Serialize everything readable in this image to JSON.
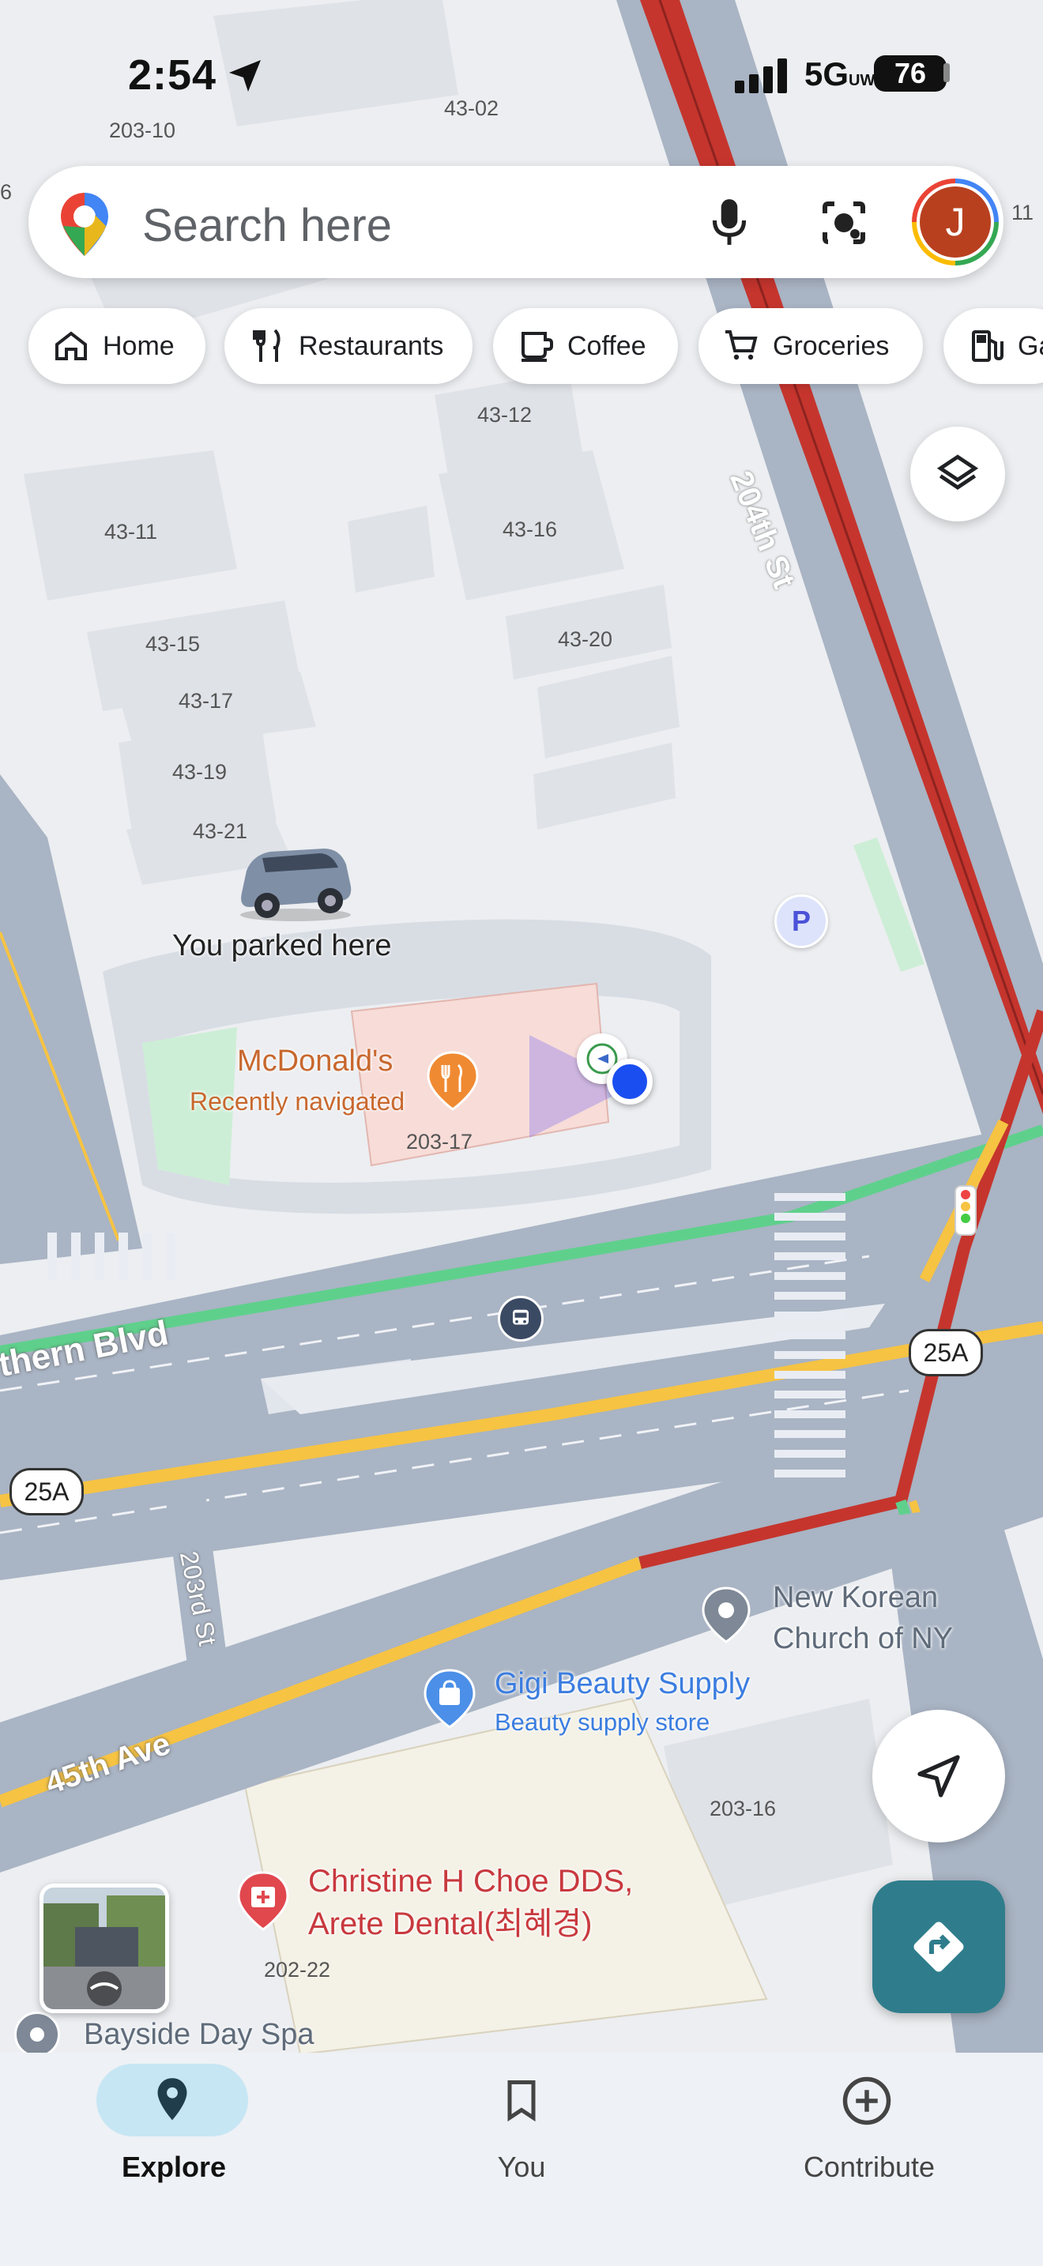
{
  "status_bar": {
    "time": "2:54",
    "network": "5G",
    "network_sub": "UW",
    "battery": "76"
  },
  "search": {
    "placeholder": "Search here",
    "avatar_letter": "J"
  },
  "chips": [
    {
      "label": "Home",
      "icon": "home-icon"
    },
    {
      "label": "Restaurants",
      "icon": "restaurant-icon"
    },
    {
      "label": "Coffee",
      "icon": "coffee-icon"
    },
    {
      "label": "Groceries",
      "icon": "cart-icon"
    },
    {
      "label": "Ga",
      "icon": "gas-icon"
    }
  ],
  "map": {
    "building_numbers": [
      "203-10",
      "43-02",
      "43-12",
      "43-11",
      "43-16",
      "43-15",
      "43-20",
      "43-17",
      "43-19",
      "43-21",
      "203-17",
      "203-16",
      "202-22",
      "6",
      "11"
    ],
    "streets": [
      "204th St",
      "thern Blvd",
      "203rd St",
      "45th Ave"
    ],
    "route_shields": [
      "25A",
      "25A"
    ],
    "parked_label": "You parked here",
    "places": {
      "mcdonalds": {
        "name": "McDonald's",
        "sub": "Recently navigated"
      },
      "church": {
        "name_line1": "New Korean",
        "name_line2": "Church of NY"
      },
      "gigi": {
        "name": "Gigi Beauty Supply",
        "sub": "Beauty supply store"
      },
      "dental": {
        "name_line1": "Christine H Choe DDS,",
        "name_line2": "Arete Dental(최혜경)"
      },
      "spa": {
        "name": "Bayside Day Spa"
      }
    },
    "parking_letter": "P"
  },
  "colors": {
    "traffic_red": "#c5352d",
    "traffic_yellow": "#f6c343",
    "traffic_green": "#5fd08c",
    "road": "#a9b4c4",
    "accent_teal": "#2f7d8c",
    "location_blue": "#1a4ef0"
  },
  "bottom_nav": [
    {
      "label": "Explore",
      "icon": "pin-icon",
      "active": true
    },
    {
      "label": "You",
      "icon": "bookmark-icon",
      "active": false
    },
    {
      "label": "Contribute",
      "icon": "plus-circle-icon",
      "active": false
    }
  ]
}
